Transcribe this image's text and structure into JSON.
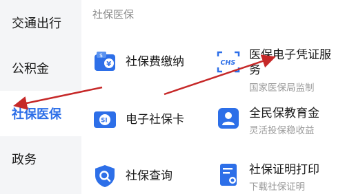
{
  "sidebar": {
    "items": [
      {
        "label": "交通出行",
        "active": false
      },
      {
        "label": "公积金",
        "active": false
      },
      {
        "label": "社保医保",
        "active": true
      },
      {
        "label": "政务",
        "active": false
      }
    ]
  },
  "section": {
    "title": "社保医保"
  },
  "tiles": [
    {
      "title": "社保费缴纳",
      "subtitle": "",
      "icon": "wallet-yuan-icon"
    },
    {
      "title": "医保电子凭证服务",
      "subtitle": "国家医保局监制",
      "icon": "chs-scan-icon"
    },
    {
      "title": "电子社保卡",
      "subtitle": "",
      "icon": "social-security-card-icon"
    },
    {
      "title": "全民保教育金",
      "subtitle": "灵活投保稳收益",
      "icon": "user-card-icon"
    },
    {
      "title": "社保查询",
      "subtitle": "",
      "icon": "shield-search-icon"
    },
    {
      "title": "社保证明打印",
      "subtitle": "下载社保证明",
      "icon": "document-print-icon"
    }
  ],
  "icon_texts": {
    "wallet": "¥",
    "wallet_tag": "$",
    "chs": "CHS",
    "card": "SI"
  },
  "colors": {
    "accent": "#2d6fe8",
    "arrow": "#c62828",
    "sidebar_bg": "#f4f5f7"
  }
}
